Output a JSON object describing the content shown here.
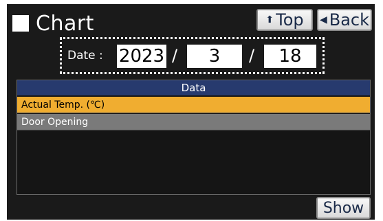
{
  "header": {
    "title": "Chart",
    "top_button": {
      "icon": "up-arrow-icon",
      "glyph": "⬆",
      "label": "Top"
    },
    "back_button": {
      "icon": "left-triangle-icon",
      "glyph": "◀",
      "label": "Back"
    }
  },
  "date": {
    "label": "Date :",
    "year": "2023",
    "month": "3",
    "day": "18",
    "separator": "/"
  },
  "data_panel": {
    "header": "Data",
    "items": [
      {
        "label": "Actual Temp. (℃)",
        "selected": true
      },
      {
        "label": "Door Opening",
        "selected": false
      }
    ]
  },
  "footer": {
    "show_label": "Show"
  },
  "colors": {
    "background": "#1a1a1a",
    "header_bar": "#273a6e",
    "selected_row": "#f0ad30",
    "normal_row": "#7a7a7a"
  }
}
